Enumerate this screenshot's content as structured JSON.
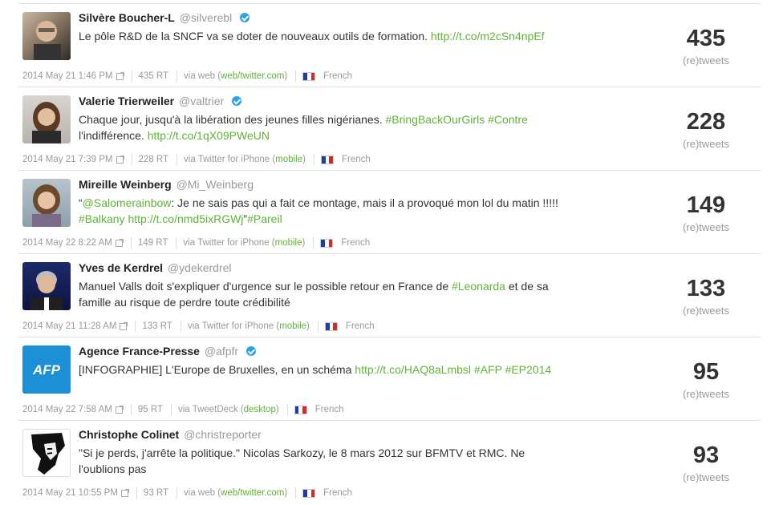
{
  "labels": {
    "retweets_label": "(re)tweets",
    "via": "via"
  },
  "tweets": [
    {
      "name": "Silvère Boucher-L",
      "handle": "@silverebl",
      "verified": true,
      "text_parts": [
        {
          "t": "Le pôle R&D de la SNCF va se doter de nouveaux outils de formation. ",
          "link": false
        },
        {
          "t": "http://t.co/m2cSn4npEf",
          "link": true
        }
      ],
      "date": "2014 May 21 1:46 PM",
      "rt": "435 RT",
      "via_text": "via web (",
      "via_link": "web/twitter.com",
      "via_close": ")",
      "language": "French",
      "count": "435"
    },
    {
      "name": "Valerie Trierweiler",
      "handle": "@valtrier",
      "verified": true,
      "text_parts": [
        {
          "t": "Chaque jour, jusqu'à la libération des jeunes filles nigérianes. ",
          "link": false
        },
        {
          "t": "#BringBackOurGirls",
          "link": true
        },
        {
          "t": " ",
          "link": false
        },
        {
          "t": "#Contre",
          "link": true
        },
        {
          "t": " l'indifférence. ",
          "link": false
        },
        {
          "t": "http://t.co/1qX09PWeUN",
          "link": true
        }
      ],
      "date": "2014 May 21 7:39 PM",
      "rt": "228 RT",
      "via_text": "via Twitter for iPhone (",
      "via_link": "mobile",
      "via_close": ")",
      "language": "French",
      "count": "228"
    },
    {
      "name": "Mireille Weinberg",
      "handle": "@Mi_Weinberg",
      "verified": false,
      "text_parts": [
        {
          "t": "“",
          "link": false
        },
        {
          "t": "@Salomerainbow",
          "link": true
        },
        {
          "t": ": Je ne sais pas qui a fait ce montage, mais il a provoqué mon lol du matin !!!!! ",
          "link": false
        },
        {
          "t": "#Balkany",
          "link": true
        },
        {
          "t": " ",
          "link": false
        },
        {
          "t": "http://t.co/nmd5ixRGWj",
          "link": true
        },
        {
          "t": "”",
          "link": false
        },
        {
          "t": "#Pareil",
          "link": true
        }
      ],
      "date": "2014 May 22 8:22 AM",
      "rt": "149 RT",
      "via_text": "via Twitter for iPhone (",
      "via_link": "mobile",
      "via_close": ")",
      "language": "French",
      "count": "149"
    },
    {
      "name": "Yves de Kerdrel",
      "handle": "@ydekerdrel",
      "verified": false,
      "text_parts": [
        {
          "t": "Manuel Valls doit s'expliquer d'urgence sur le possible retour en France de ",
          "link": false
        },
        {
          "t": "#Leonarda",
          "link": true
        },
        {
          "t": " et de sa famille au risque de perdre toute crédibilité",
          "link": false
        }
      ],
      "date": "2014 May 21 11:28 AM",
      "rt": "133 RT",
      "via_text": "via Twitter for iPhone (",
      "via_link": "mobile",
      "via_close": ")",
      "language": "French",
      "count": "133"
    },
    {
      "name": "Agence France-Presse",
      "handle": "@afpfr",
      "verified": true,
      "text_parts": [
        {
          "t": "[INFOGRAPHIE] L'Europe de Bruxelles, en un schéma ",
          "link": false
        },
        {
          "t": "http://t.co/HAQ8aLmbsl",
          "link": true
        },
        {
          "t": " ",
          "link": false
        },
        {
          "t": "#AFP",
          "link": true
        },
        {
          "t": " ",
          "link": false
        },
        {
          "t": "#EP2014",
          "link": true
        }
      ],
      "date": "2014 May 22 7:58 AM",
      "rt": "95 RT",
      "via_text": "via TweetDeck (",
      "via_link": "desktop",
      "via_close": ")",
      "language": "French",
      "count": "95"
    },
    {
      "name": "Christophe Colinet",
      "handle": "@christreporter",
      "verified": false,
      "text_parts": [
        {
          "t": "\"Si je perds, j'arrête la politique.\" Nicolas Sarkozy, le 8 mars 2012 sur BFMTV et RMC. Ne l'oublions pas",
          "link": false
        }
      ],
      "date": "2014 May 21 10:55 PM",
      "rt": "93 RT",
      "via_text": "via web (",
      "via_link": "web/twitter.com",
      "via_close": ")",
      "language": "French",
      "count": "93"
    }
  ],
  "avatar_logo_text": "AFP"
}
